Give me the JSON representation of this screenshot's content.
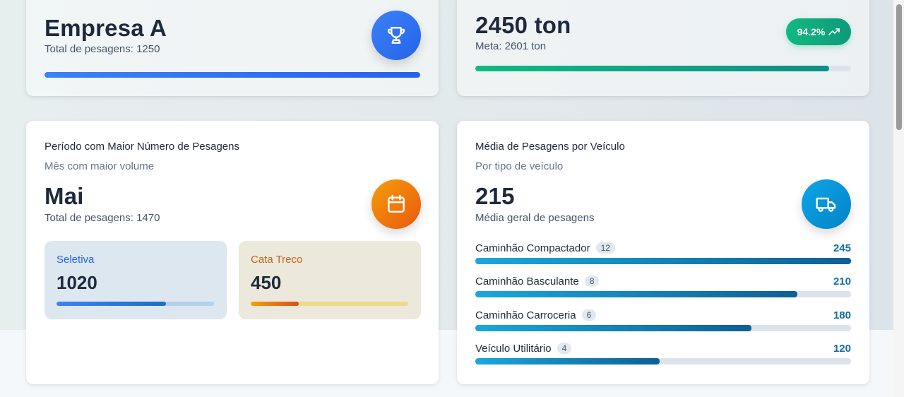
{
  "card_company": {
    "name": "Empresa A",
    "subtitle": "Total de pesagens: 1250",
    "icon": "trophy-icon",
    "progress": 1.0
  },
  "card_tonnage": {
    "value": "2450 ton",
    "goal": "Meta: 2601 ton",
    "badge": "94.2%",
    "badge_icon": "trending-up-icon",
    "progress": 0.942
  },
  "card_period": {
    "title": "Período com Maior Número de Pesagens",
    "subtitle": "Mês com maior volume",
    "value": "Mai",
    "total": "Total de pesagens: 1470",
    "icon": "calendar-icon",
    "breakdown": [
      {
        "label": "Seletiva",
        "value": "1020",
        "fraction": 0.694
      },
      {
        "label": "Cata Treco",
        "value": "450",
        "fraction": 0.306
      }
    ]
  },
  "card_vehicle": {
    "title": "Média de Pesagens por Veículo",
    "subtitle": "Por tipo de veículo",
    "value": "215",
    "caption": "Média geral de pesagens",
    "icon": "truck-icon",
    "rows": [
      {
        "name": "Caminhão Compactador",
        "count": "12",
        "value": "245",
        "fraction": 1.0
      },
      {
        "name": "Caminhão Basculante",
        "count": "8",
        "value": "210",
        "fraction": 0.857
      },
      {
        "name": "Caminhão Carroceria",
        "count": "6",
        "value": "180",
        "fraction": 0.735
      },
      {
        "name": "Veículo Utilitário",
        "count": "4",
        "value": "120",
        "fraction": 0.49
      }
    ]
  },
  "colors": {
    "blue": "#3b82f6",
    "green": "#10b981",
    "orange": "#f59e0b",
    "cyan": "#0ea5e9"
  }
}
